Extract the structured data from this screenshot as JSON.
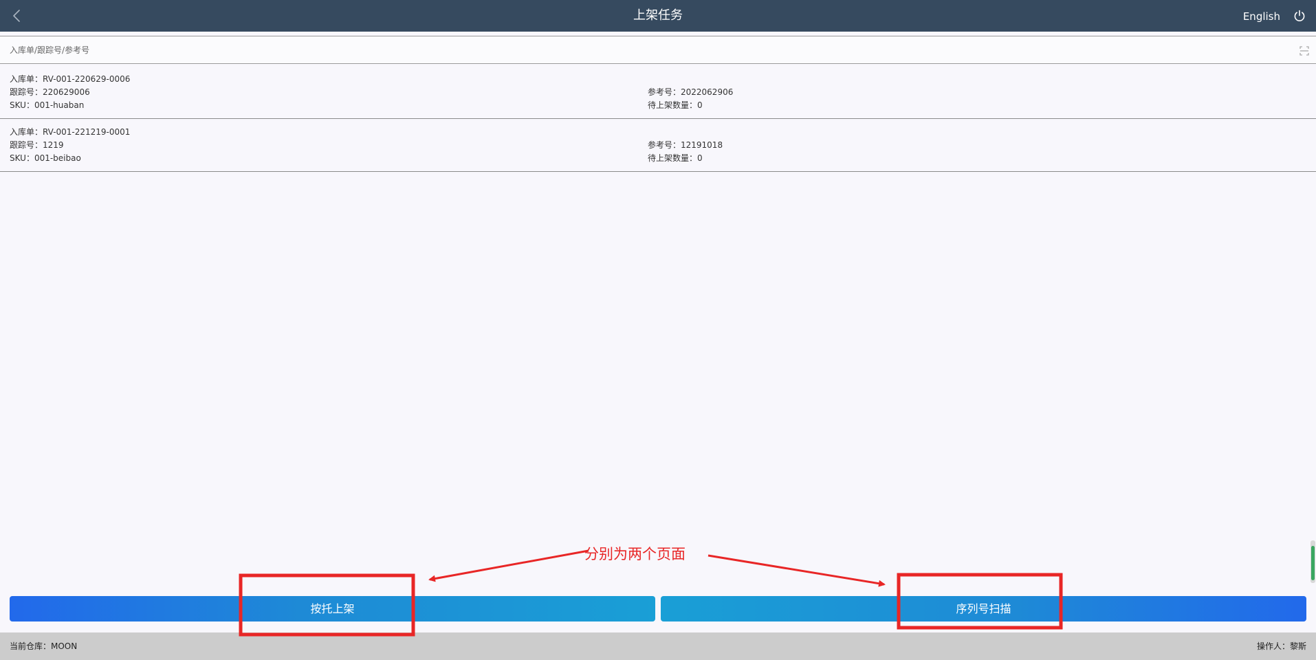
{
  "header": {
    "title": "上架任务",
    "language": "English"
  },
  "search": {
    "placeholder": "入库单/跟踪号/参考号"
  },
  "records": [
    {
      "inbound": "入库单：RV-001-220629-0006",
      "tracking": "跟踪号：220629006",
      "sku": "SKU：001-huaban",
      "reference": "参考号：2022062906",
      "pending_qty": "待上架数量：0"
    },
    {
      "inbound": "入库单：RV-001-221219-0001",
      "tracking": "跟踪号：1219",
      "sku": "SKU：001-beibao",
      "reference": "参考号：12191018",
      "pending_qty": "待上架数量：0"
    }
  ],
  "actions": {
    "pallet_shelving": "按托上架",
    "serial_scan": "序列号扫描"
  },
  "footer": {
    "warehouse": "当前仓库：MOON",
    "operator": "操作人：黎斯"
  },
  "annotation": {
    "text": "分别为两个页面",
    "color": "#e82626"
  },
  "colors": {
    "header_bg": "#364a5f",
    "page_bg": "#f8f7fc",
    "button_blue": "#2269eb",
    "button_cyan": "#1a9fd6",
    "footer_bg": "#cccccc",
    "scrollbar": "#3aa660"
  },
  "icons": {
    "back": "chevron-left-icon",
    "power": "power-icon",
    "scan": "scan-icon"
  }
}
